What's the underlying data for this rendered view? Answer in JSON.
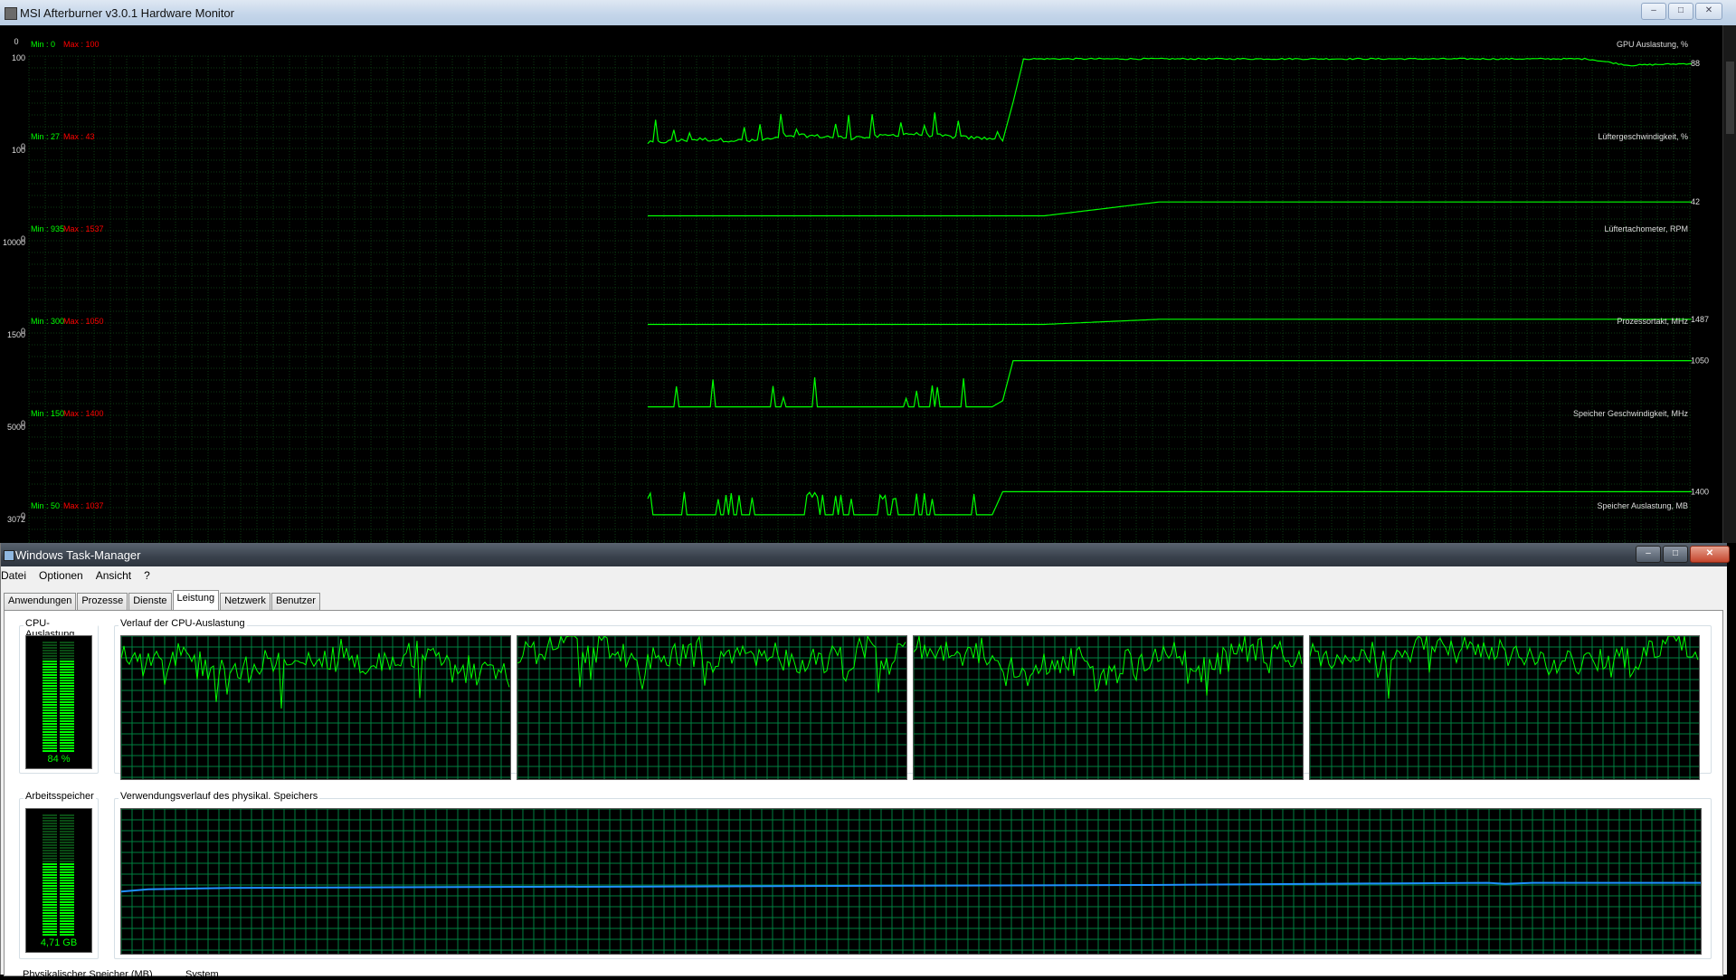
{
  "afterburner": {
    "title": "MSI Afterburner v3.0.1 Hardware Monitor",
    "colors": {
      "line": "#00ff00",
      "grid": "#0b3a12",
      "min": "#00ff00",
      "max": "#ff0000"
    },
    "panels": [
      {
        "name": "GPU Auslastung, %",
        "min_label": "Min : 0",
        "max_label": "Max : 100",
        "y_top": "100",
        "y_bottom": "0",
        "current": "88",
        "ymin": 0,
        "ymax": 100
      },
      {
        "name": "Lüftergeschwindigkeit, %",
        "min_label": "Min : 27",
        "max_label": "Max : 43",
        "y_top": "100",
        "y_bottom": "0",
        "current": "42",
        "ymin": 0,
        "ymax": 100
      },
      {
        "name": "Lüftertachometer, RPM",
        "min_label": "Min : 935",
        "max_label": "Max : 1537",
        "y_top": "10000",
        "y_bottom": "0",
        "current": "1487",
        "ymin": 0,
        "ymax": 10000
      },
      {
        "name": "Prozessortakt, MHz",
        "min_label": "Min : 300",
        "max_label": "Max : 1050",
        "y_top": "1500",
        "y_bottom": "0",
        "current": "1050",
        "ymin": 0,
        "ymax": 1500
      },
      {
        "name": "Speicher Geschwindigkeit, MHz",
        "min_label": "Min : 150",
        "max_label": "Max : 1400",
        "y_top": "5000",
        "y_bottom": "0",
        "current": "1400",
        "ymin": 0,
        "ymax": 5000
      },
      {
        "name": "Speicher Auslastung, MB",
        "min_label": "Min : 50",
        "max_label": "Max : 1037",
        "y_top": "3072",
        "y_bottom": "",
        "current": "",
        "ymin": 0,
        "ymax": 3072
      }
    ],
    "top_axis_label": "0"
  },
  "chart_data": [
    {
      "type": "line",
      "name": "GPU Auslastung, %",
      "ylim": [
        0,
        100
      ],
      "x": [
        0,
        5,
        10,
        15,
        20,
        25,
        30,
        34,
        35,
        36,
        40,
        50,
        60,
        70,
        80,
        90,
        94,
        100
      ],
      "y": [
        4,
        8,
        6,
        12,
        9,
        14,
        10,
        8,
        50,
        97,
        97,
        97,
        97,
        97,
        97,
        97,
        90,
        92
      ]
    },
    {
      "type": "line",
      "name": "Lüftergeschwindigkeit, %",
      "ylim": [
        0,
        100
      ],
      "x": [
        0,
        38,
        49,
        100
      ],
      "y": [
        27,
        27,
        42,
        42
      ]
    },
    {
      "type": "line",
      "name": "Lüftertachometer, RPM",
      "ylim": [
        0,
        10000
      ],
      "x": [
        0,
        38,
        49,
        100
      ],
      "y": [
        935,
        935,
        1487,
        1487
      ]
    },
    {
      "type": "line",
      "name": "Prozessortakt, MHz",
      "ylim": [
        0,
        1500
      ],
      "x": [
        0,
        33,
        34,
        35,
        100
      ],
      "y": [
        300,
        300,
        400,
        1050,
        1050
      ]
    },
    {
      "type": "line",
      "name": "Speicher Geschwindigkeit, MHz",
      "ylim": [
        0,
        5000
      ],
      "x": [
        0,
        33,
        34,
        100
      ],
      "y": [
        150,
        150,
        1400,
        1400
      ]
    }
  ],
  "taskmanager": {
    "title": "Windows Task-Manager",
    "menu": [
      "Datei",
      "Optionen",
      "Ansicht",
      "?"
    ],
    "tabs": [
      "Anwendungen",
      "Prozesse",
      "Dienste",
      "Leistung",
      "Netzwerk",
      "Benutzer"
    ],
    "active_tab": "Leistung",
    "cpu_label": "CPU-Auslastung",
    "cpu_value": "84 %",
    "cpu_fraction": 0.84,
    "cpu_history_label": "Verlauf der CPU-Auslastung",
    "mem_label": "Arbeitsspeicher",
    "mem_value": "4,71 GB",
    "mem_fraction": 0.59,
    "mem_history_label": "Verwendungsverlauf des physikal. Speichers",
    "bottom_label_1": "Physikalischer Speicher (MB)",
    "bottom_label_2": "System",
    "colors": {
      "cpu_line": "#00ff00",
      "mem_line": "#1e90ff",
      "grid": "#008040"
    }
  }
}
